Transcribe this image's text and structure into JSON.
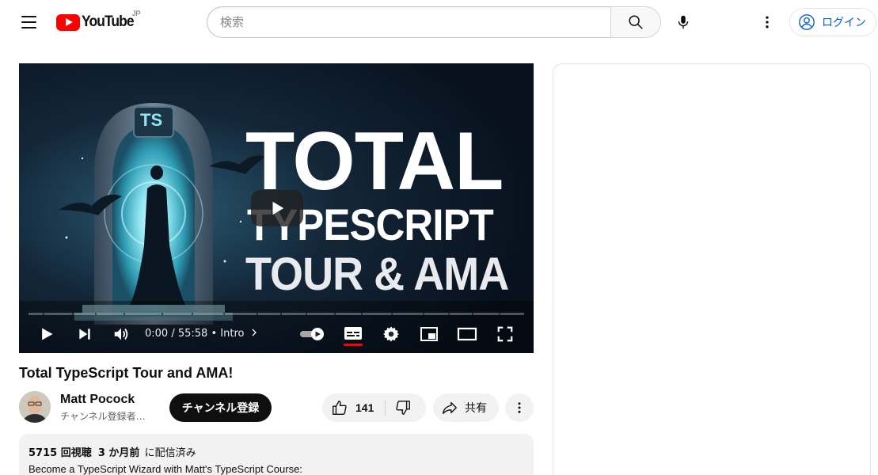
{
  "header": {
    "logo_text": "YouTube",
    "region_code": "JP",
    "search_placeholder": "検索",
    "login_label": "ログイン"
  },
  "player": {
    "thumbnail_badge": "TS",
    "thumbnail_title_line1": "TOTAL",
    "thumbnail_title_line2": "TYPESCRIPT",
    "thumbnail_title_line3": "TOUR & AMA",
    "current_time": "0:00",
    "duration": "55:58",
    "chapter": "Intro",
    "progress": 0,
    "captions_enabled": true,
    "autoplay_toggle": "on"
  },
  "video": {
    "title": "Total TypeScript Tour and AMA!",
    "channel_name": "Matt Pocock",
    "subscribers": "チャンネル登録者…",
    "subscribe_label": "チャンネル登録",
    "like_count": "141",
    "share_label": "共有",
    "view_count": "5715 回視聴",
    "published": "3 か月前",
    "published_suffix": "に配信済み",
    "description_first_line": "Become a TypeScript Wizard with Matt's TypeScript Course:"
  },
  "colors": {
    "brand_red": "#ff0000",
    "link_blue": "#065fd4",
    "chip_bg": "#f2f2f2",
    "text_primary": "#0f0f0f",
    "text_secondary": "#606060"
  },
  "icons": [
    "menu-icon",
    "youtube-logo-icon",
    "search-icon",
    "mic-icon",
    "more-vert-icon",
    "account-icon",
    "play-icon",
    "next-icon",
    "volume-icon",
    "chevron-right-icon",
    "autoplay-toggle-icon",
    "captions-icon",
    "settings-icon",
    "miniplayer-icon",
    "theater-icon",
    "fullscreen-icon",
    "like-icon",
    "dislike-icon",
    "share-icon",
    "more-horiz-icon"
  ]
}
